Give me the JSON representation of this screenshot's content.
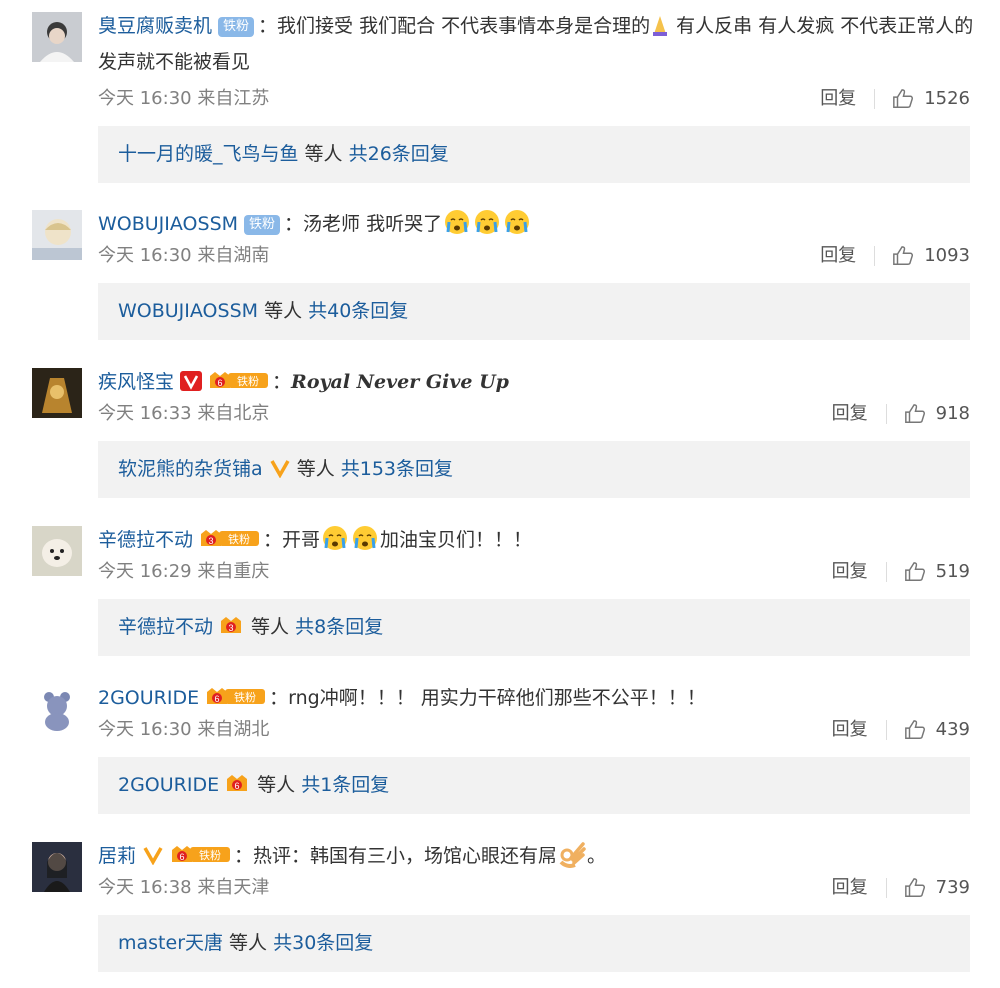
{
  "comments": [
    {
      "username": "臭豆腐贩卖机",
      "badge": "铁粉",
      "text": "：我们接受 我们配合 不代表事情本身是合理的",
      "text_after": " 有人反串 有人发疯 不代表正常人的发声就不能被看见",
      "time": "今天 16:30",
      "location": "来自江苏",
      "reply_label": "回复",
      "likes": "1526",
      "reply_users": "十一月的暖_飞鸟与鱼",
      "reply_mid": " 等人 ",
      "reply_count": "共26条回复"
    },
    {
      "username": "WOBUJIAOSSM",
      "badge": "铁粉",
      "text": "：汤老师 我听哭了",
      "time": "今天 16:30",
      "location": "来自湖南",
      "reply_label": "回复",
      "likes": "1093",
      "reply_users": "WOBUJIAOSSM",
      "reply_mid": " 等人 ",
      "reply_count": "共40条回复"
    },
    {
      "username": "疾风怪宝",
      "badge": "铁粉",
      "fan_level": "6",
      "colon": "：",
      "text": "Royal Never Give Up",
      "time": "今天 16:33",
      "location": "来自北京",
      "reply_label": "回复",
      "likes": "918",
      "reply_users": "软泥熊的杂货铺a",
      "reply_mid": " 等人 ",
      "reply_count": "共153条回复"
    },
    {
      "username": "辛德拉不动",
      "badge": "铁粉",
      "fan_level": "3",
      "text": "：开哥",
      "text_after": "加油宝贝们！！！",
      "time": "今天 16:29",
      "location": "来自重庆",
      "reply_label": "回复",
      "likes": "519",
      "reply_users": "辛德拉不动",
      "reply_fan_level": "3",
      "reply_mid": " 等人 ",
      "reply_count": "共8条回复"
    },
    {
      "username": "2GOURIDE",
      "badge": "铁粉",
      "fan_level": "6",
      "text": "：rng冲啊！！！ 用实力干碎他们那些不公平！！！",
      "time": "今天 16:30",
      "location": "来自湖北",
      "reply_label": "回复",
      "likes": "439",
      "reply_users": "2GOURIDE",
      "reply_fan_level": "6",
      "reply_mid": " 等人 ",
      "reply_count": "共1条回复"
    },
    {
      "username": "居莉",
      "badge": "铁粉",
      "fan_level": "6",
      "text": "：热评：韩国有三小，场馆心眼还有屌",
      "text_after": "。",
      "time": "今天 16:38",
      "location": "来自天津",
      "reply_label": "回复",
      "likes": "739",
      "reply_users": "master天唐",
      "reply_mid": " 等人 ",
      "reply_count": "共30条回复"
    }
  ],
  "icons": {
    "like": "thumbs-up-icon",
    "vip_red": "red-v-icon",
    "vip_gold": "gold-v-icon",
    "fan_badge": "fan-level-badge-icon"
  },
  "colors": {
    "link": "#1c5d9c",
    "meta": "#808080",
    "reply_bg": "#f2f2f2",
    "badge_blue": "#8ab8e8",
    "badge_orange": "#f7a21b",
    "vip_red": "#e02020"
  }
}
